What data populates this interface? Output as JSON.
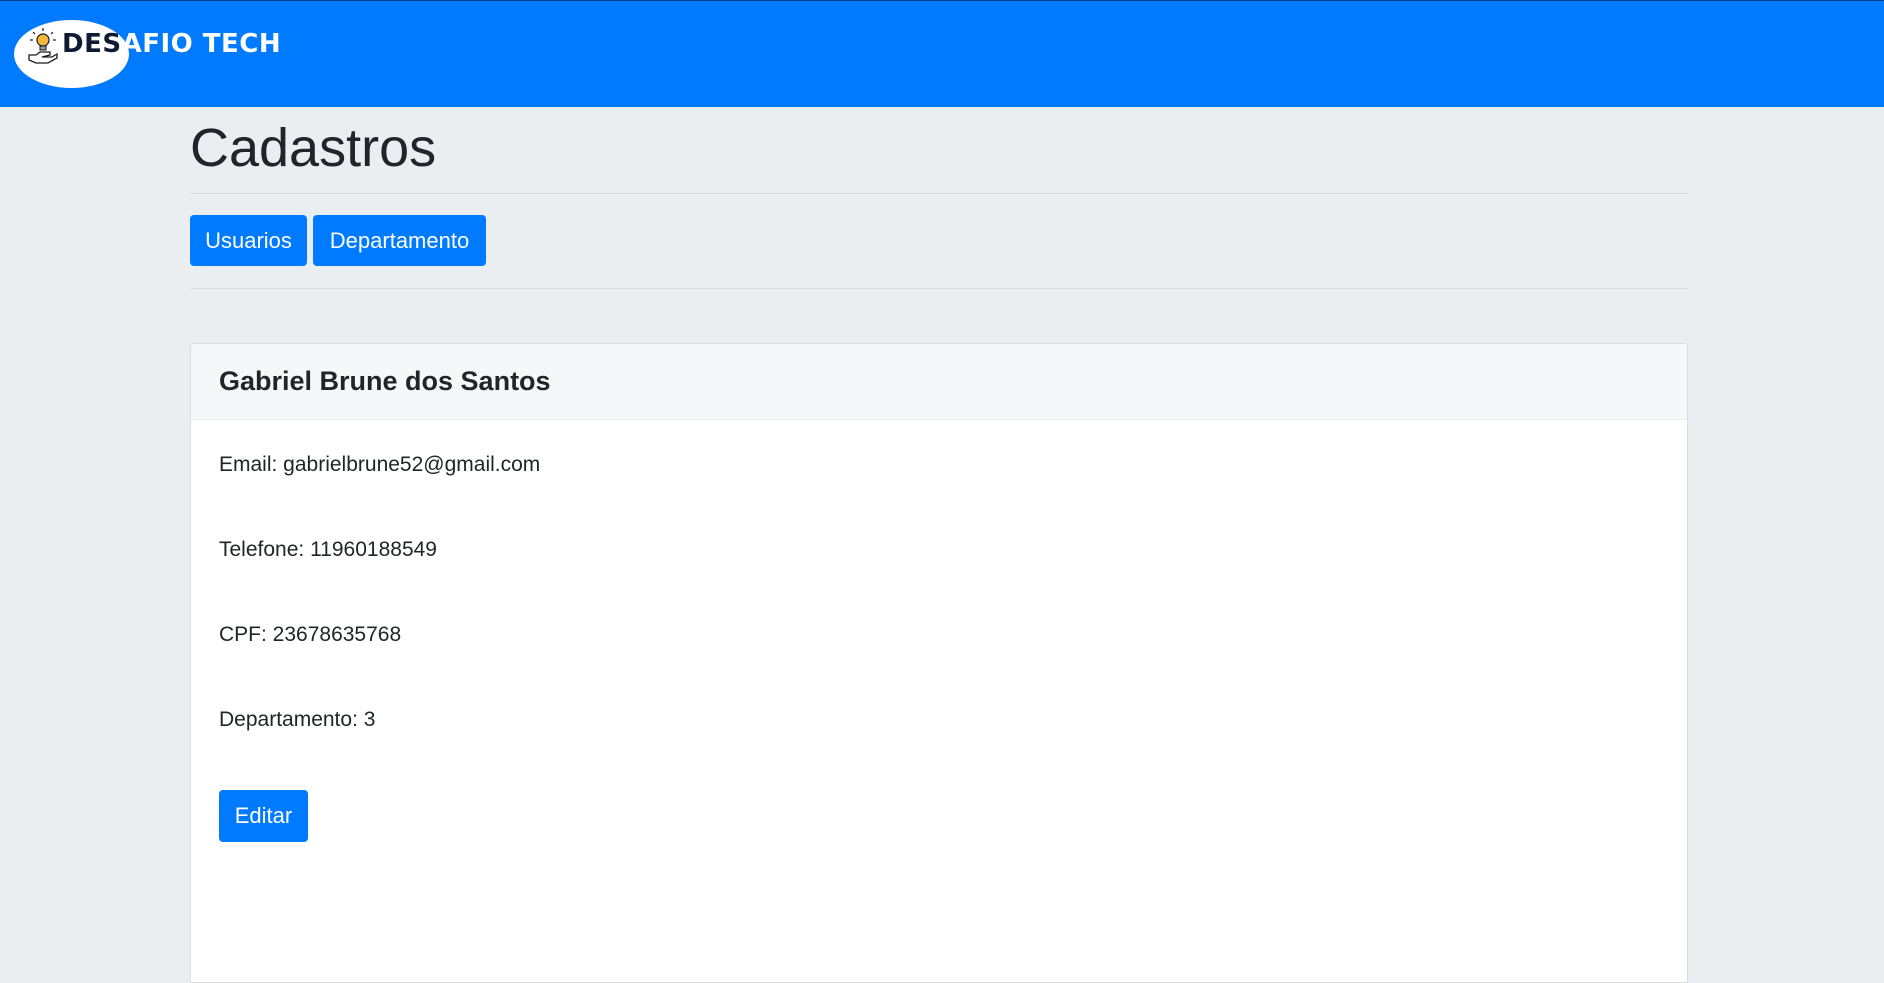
{
  "header": {
    "logo_text_dark": "DES",
    "logo_text_light": "AFIO TECH",
    "logo_icon": "lightbulb-hand-icon",
    "bar_color": "#007bff"
  },
  "page": {
    "title": "Cadastros"
  },
  "nav_buttons": {
    "usuarios_label": "Usuarios",
    "departamento_label": "Departamento"
  },
  "card": {
    "name": "Gabriel Brune dos Santos",
    "email": "Email: gabrielbrune52@gmail.com",
    "telefone": "Telefone: 11960188549",
    "cpf": "CPF: 23678635768",
    "departamento": "Departamento: 3",
    "edit_label": "Editar"
  },
  "colors": {
    "accent": "#007bff",
    "background": "#eaeef1",
    "text": "#212529"
  }
}
